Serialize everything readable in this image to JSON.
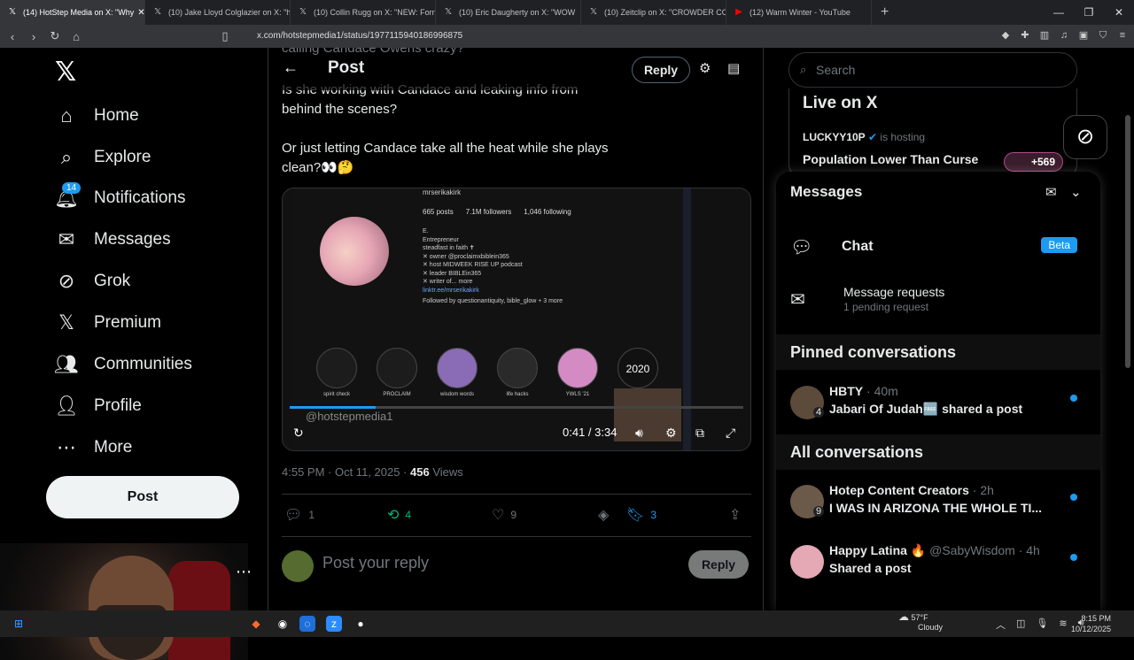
{
  "browser": {
    "tabs": [
      {
        "title": "(14) HotStep Media on X: \"Why",
        "active": true
      },
      {
        "title": "(10) Jake Lloyd Colglazier on X: \"http"
      },
      {
        "title": "(10) Collin Rugg on X: \"NEW: Former"
      },
      {
        "title": "(10) Eric Daugherty on X: \"WOW"
      },
      {
        "title": "(10) Zeitclip on X: \"CROWDER CO"
      },
      {
        "title": "(12) Warm Winter - YouTube"
      }
    ],
    "url": "x.com/hotstepmedia1/status/1977115940186996875"
  },
  "nav": {
    "items": [
      {
        "label": "Home",
        "icon": "home-icon"
      },
      {
        "label": "Explore",
        "icon": "search-icon"
      },
      {
        "label": "Notifications",
        "icon": "bell-icon",
        "badge": "14"
      },
      {
        "label": "Messages",
        "icon": "mail-icon"
      },
      {
        "label": "Grok",
        "icon": "grok-icon"
      },
      {
        "label": "Premium",
        "icon": "x-icon"
      },
      {
        "label": "Communities",
        "icon": "people-icon"
      },
      {
        "label": "Profile",
        "icon": "person-icon"
      },
      {
        "label": "More",
        "icon": "more-circle-icon"
      }
    ],
    "post_label": "Post"
  },
  "post": {
    "header_title": "Post",
    "reply_label": "Reply",
    "top_fragment": "calling Candace Owens crazy?",
    "text1": "Is she working with Candace and leaking info from behind the scenes?",
    "text2": "Or just letting Candace take all the heat while she plays clean?👀🤔",
    "video": {
      "watermark": "@hotstepmedia1",
      "time": "0:41 / 3:34",
      "progress": 0.19,
      "ig_handle": "mrserikakirk",
      "ig_posts": "665 posts",
      "ig_followers": "7.1M followers",
      "ig_following": "1,046 following",
      "ig_bio": [
        "E.",
        "Entrepreneur",
        "steadfast in faith ✝",
        "✕ owner @proclaimxbiblein365",
        "✕ host MIDWEEK RISE UP podcast",
        "✕ leader BIBLEin365",
        "✕ writer of... more",
        "linktr.ee/mrserikakirk",
        "Followed by questionantiquity, bible_glow + 3 more"
      ],
      "highlights": [
        "spirit check",
        "PROCLAIM",
        "wisdom words",
        "life hacks",
        "YWLS '21",
        "2020"
      ]
    },
    "timestamp": "4:55 PM · Oct 11, 2025 · ",
    "views_count": "456",
    "views_label": " Views",
    "replies": "1",
    "reposts": "4",
    "likes": "9",
    "bookmarks": "3",
    "reply_placeholder": "Post your reply",
    "reply_button": "Reply"
  },
  "sidebar": {
    "search_placeholder": "Search",
    "live_title": "Live on X",
    "live_host": "LUCKYY10P",
    "live_hosting": " is hosting",
    "live_name": "Population Lower Than Curse",
    "live_count": "+569"
  },
  "messages": {
    "title": "Messages",
    "chat_label": "Chat",
    "beta": "Beta",
    "requests_title": "Message requests",
    "requests_sub": "1 pending request",
    "pinned_heading": "Pinned conversations",
    "all_heading": "All conversations",
    "pinned": [
      {
        "name": "HBTY",
        "meta": " · 40m",
        "preview": "Jabari Of Judah🆓 shared a post",
        "count": "4"
      }
    ],
    "all": [
      {
        "name": "Hotep Content Creators",
        "meta": " · 2h",
        "preview": "I WAS IN ARIZONA THE WHOLE TI...",
        "count": "9"
      },
      {
        "name": "Happy Latina 🔥",
        "meta": " @SabyWisdom · 4h",
        "preview": "Shared a post"
      }
    ]
  },
  "taskbar": {
    "temp": "57°F",
    "weather": "Cloudy",
    "time": "8:15 PM",
    "date": "10/12/2025"
  },
  "colors": {
    "accent": "#1d9bf0",
    "repost": "#00ba7c",
    "background": "#000000"
  }
}
